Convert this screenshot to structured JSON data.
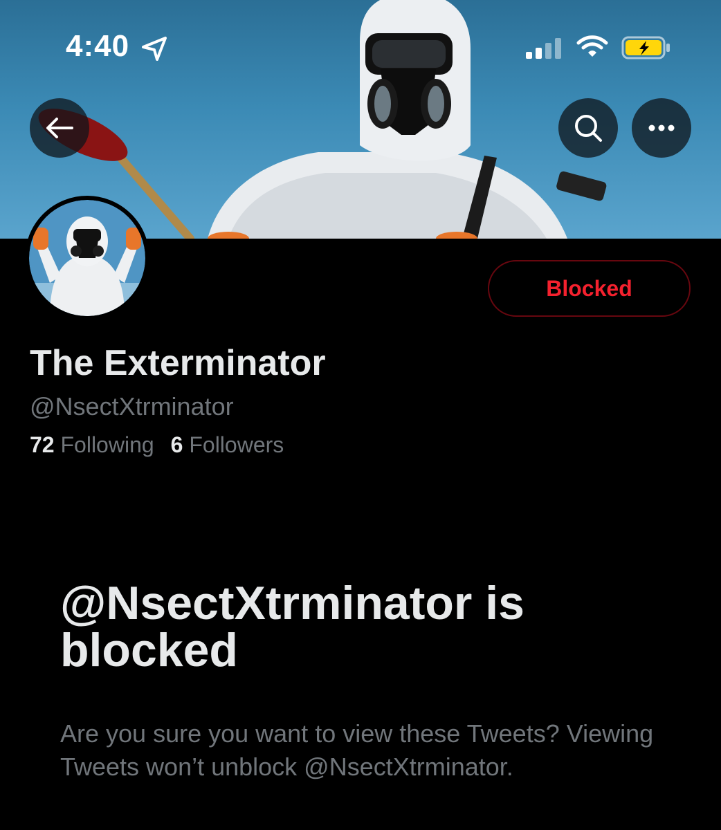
{
  "status_bar": {
    "time": "4:40"
  },
  "header": {
    "back_icon": "arrow-left-icon",
    "search_icon": "search-icon",
    "more_icon": "more-horizontal-icon"
  },
  "profile": {
    "display_name": "The Exterminator",
    "handle": "@NsectXtrminator",
    "following_count": "72",
    "following_label": "Following",
    "followers_count": "6",
    "followers_label": "Followers",
    "blocked_button_label": "Blocked"
  },
  "blocked_notice": {
    "title": "@NsectXtrminator is blocked",
    "body": "Are you sure you want to view these Tweets? Viewing Tweets won’t unblock @NsectXtrminator."
  },
  "colors": {
    "background": "#000000",
    "blocked_red": "#f4212e",
    "secondary_text": "#71767b",
    "primary_text": "#e7e9ea",
    "battery_charging": "#ffd60a"
  }
}
